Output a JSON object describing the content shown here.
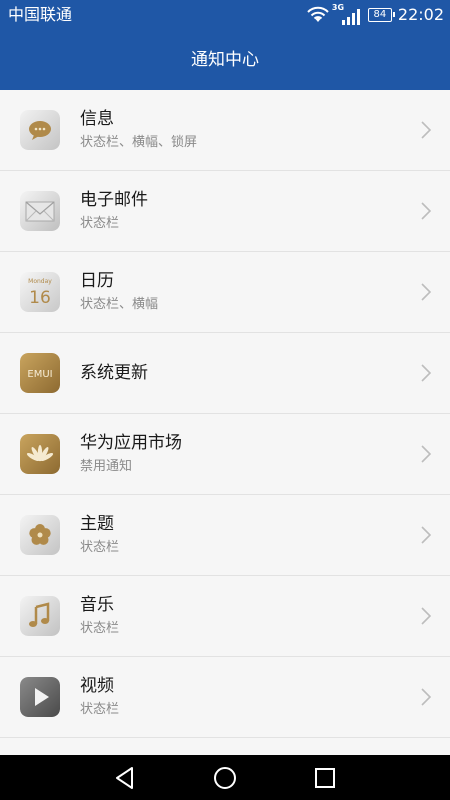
{
  "status_bar": {
    "carrier": "中国联通",
    "network_type": "3G",
    "battery_level": "84",
    "time": "22:02"
  },
  "header": {
    "title": "通知中心"
  },
  "apps": [
    {
      "name": "信息",
      "subtitle": "状态栏、横幅、锁屏",
      "icon": "messages-icon"
    },
    {
      "name": "电子邮件",
      "subtitle": "状态栏",
      "icon": "email-icon"
    },
    {
      "name": "日历",
      "subtitle": "状态栏、横幅",
      "icon": "calendar-icon",
      "icon_text_top": "Monday",
      "icon_text_day": "16"
    },
    {
      "name": "系统更新",
      "subtitle": "",
      "icon": "system-update-icon",
      "icon_text": "EMUI"
    },
    {
      "name": "华为应用市场",
      "subtitle": "禁用通知",
      "icon": "huawei-appgallery-icon"
    },
    {
      "name": "主题",
      "subtitle": "状态栏",
      "icon": "themes-icon"
    },
    {
      "name": "音乐",
      "subtitle": "状态栏",
      "icon": "music-icon"
    },
    {
      "name": "视频",
      "subtitle": "状态栏",
      "icon": "video-icon"
    }
  ],
  "colors": {
    "header_background": "#1f57a6",
    "list_background": "#f6f6f6",
    "divider": "#e2e2e2",
    "primary_text": "#1a1a1a",
    "secondary_text": "#8a8a8a",
    "gold_accent": "#b08a4a",
    "nav_bar": "#000000"
  },
  "nav_bar": {
    "buttons": [
      "back-icon",
      "home-icon",
      "recent-apps-icon"
    ]
  }
}
